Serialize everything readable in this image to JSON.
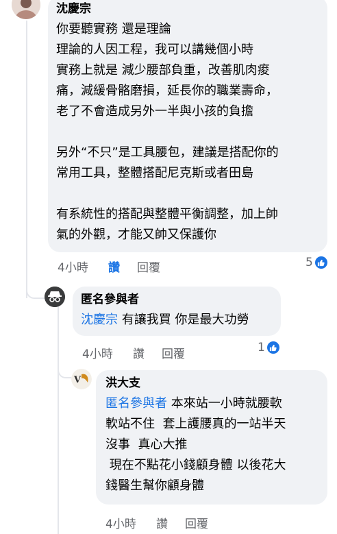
{
  "comments": [
    {
      "author": "沈慶宗",
      "paragraphs": [
        "你要聽實務 還是理論\n理論的人因工程，我可以講幾個小時\n實務上就是 減少腰部負重，改善肌肉痠\n痛，減緩骨骼磨損，延長你的職業壽命，\n老了不會造成另外一半與小孩的負擔",
        "另外“不只”是工具腰包，建議是搭配你的\n常用工具，整體搭配尼克斯或者田島",
        "有系統性的搭配與整體平衡調整，加上帥\n氣的外觀，才能又帥又保護你"
      ],
      "time": "4小時",
      "like_label": "讚",
      "reply_label": "回覆",
      "reaction_count": "5",
      "reaction_icon": "like-icon"
    },
    {
      "author": "匿名參與者",
      "mention": "沈慶宗",
      "text": " 有讓我買 你是最大功勞",
      "time": "4小時",
      "like_label": "讚",
      "reply_label": "回覆",
      "reaction_count": "1",
      "reaction_icon": "like-icon",
      "avatar_icon": "anonymous-participant-icon"
    },
    {
      "author": "洪大支",
      "mention": "匿名參與者",
      "lines": [
        " 本來站一小時就腰軟",
        "軟站不住  套上護腰真的一站半天",
        "沒事  真心大推",
        " 現在不點花小錢顧身體 以後花大",
        "錢醫生幫你顧身體"
      ],
      "time": "4小時",
      "like_label": "讚",
      "reply_label": "回覆"
    }
  ],
  "colors": {
    "bubble": "#f0f2f5",
    "link": "#1b74e4",
    "meta": "#65676b"
  }
}
